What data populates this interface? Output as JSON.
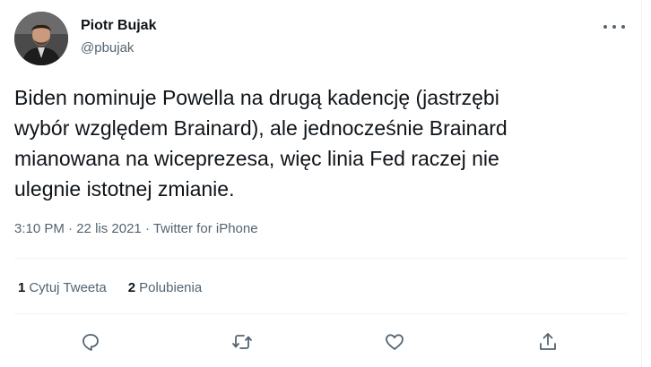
{
  "author": {
    "display_name": "Piotr Bujak",
    "handle": "@pbujak"
  },
  "tweet": {
    "text": "Biden nominuje Powella na drugą kadencję (jastrzębi\nwybór względem Brainard), ale jednocześnie Brainard\nmianowana na wiceprezesa, więc linia Fed raczej nie\nulegnie istotnej zmianie.",
    "time": "3:10 PM",
    "separator": " · ",
    "date": "22 lis 2021",
    "source": "Twitter for iPhone"
  },
  "stats": {
    "quote_count": "1",
    "quote_label": "Cytuj Tweeta",
    "like_count": "2",
    "like_label": "Polubienia"
  },
  "icons": {
    "more": "more-horizontal-icon",
    "reply": "reply-icon",
    "retweet": "retweet-icon",
    "like": "heart-icon",
    "share": "share-icon"
  },
  "colors": {
    "text_primary": "#0f1419",
    "text_secondary": "#536471",
    "divider": "#eff3f4"
  }
}
